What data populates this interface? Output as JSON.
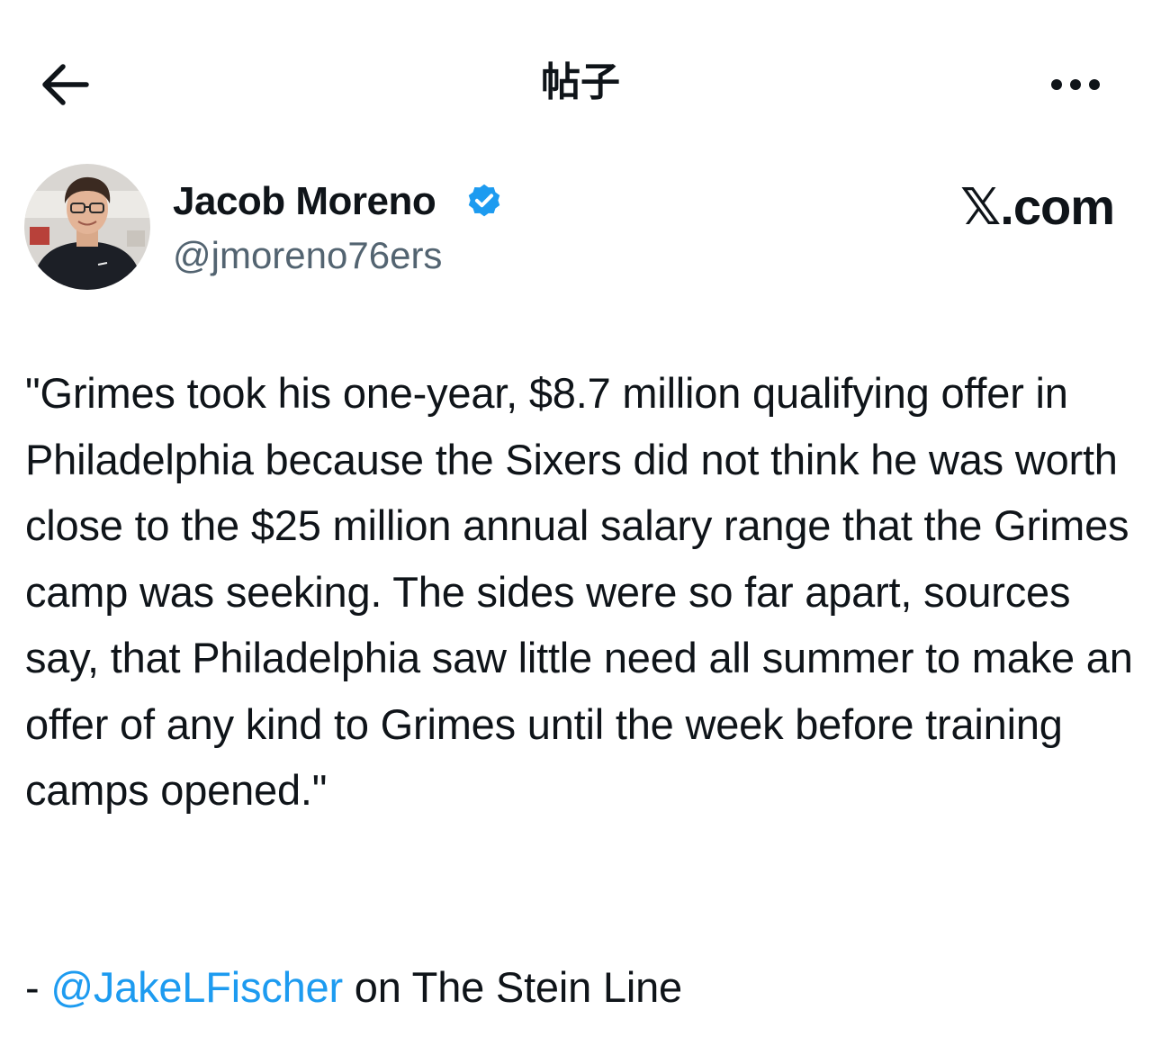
{
  "header": {
    "back_icon": "arrow-left-icon",
    "title": "帖子",
    "more_icon": "more-horizontal-icon"
  },
  "author": {
    "display_name": "Jacob Moreno",
    "handle": "@jmoreno76ers",
    "verified_icon": "verified-badge-icon",
    "verified_color": "#1d9bf0",
    "source_mark": "𝕏.com"
  },
  "tweet": {
    "text": "\"Grimes took his one-year, $8.7 million qualifying offer in Philadelphia because the Sixers did not think he was worth close to the $25 million annual salary range that the Grimes camp was seeking. The sides were so far apart, sources say, that Philadelphia saw little need all summer to make an offer of any kind to Grimes until the week before training camps opened.\"",
    "attribution": {
      "prefix": "- ",
      "mention": "@JakeLFischer",
      "suffix": " on The Stein Line"
    }
  },
  "colors": {
    "text": "#0f1419",
    "secondary": "#536471",
    "link": "#1d9bf0",
    "background": "#ffffff"
  }
}
